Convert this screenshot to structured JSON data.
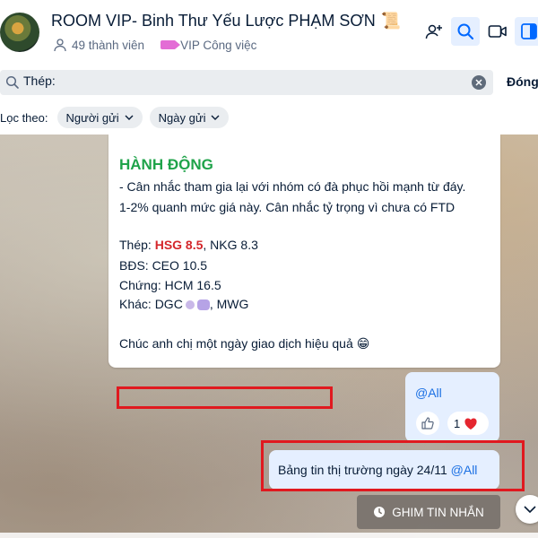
{
  "header": {
    "title": "ROOM VIP- Binh Thư Yếu Lược PHẠM SƠN",
    "title_emoji": "📜",
    "member_count": "49 thành viên",
    "category_tag": "VIP Công việc",
    "icons": [
      "add-member-icon",
      "search-icon",
      "video-call-icon",
      "sidebar-toggle-icon"
    ]
  },
  "search": {
    "query": "Thép:",
    "close_label": "Đóng"
  },
  "filters": {
    "label": "Lọc theo:",
    "sender": "Người gửi",
    "date": "Ngày gửi"
  },
  "messages": {
    "main": {
      "heading": "HÀNH ĐỘNG",
      "line1": "- Cân nhắc tham gia lại với nhóm có đà phục hồi mạnh từ đáy.",
      "line2": "1-2% quanh mức giá này. Cân nhắc tỷ trọng vì chưa có FTD",
      "steel_label": "Thép: ",
      "steel_hl": "HSG 8.5",
      "steel_rest": ", NKG 8.3",
      "bds": "BĐS: CEO 10.5",
      "securities": "Chứng: HCM 16.5",
      "other_label": "Khác: DGC",
      "other_rest": ", MWG",
      "closing": "Chúc anh chị một ngày giao dịch hiệu quả",
      "closing_emoji": "😁"
    },
    "mention_all": {
      "text": "@All",
      "reaction_count": "1"
    },
    "news": {
      "text": "Bảng tin thị trường ngày 24/11 ",
      "mention": "@All"
    }
  },
  "pin_button": "GHIM TIN NHẮN",
  "colors": {
    "accent": "#1a6fe3",
    "heading_green": "#1fa34a",
    "highlight_red": "#d4262b",
    "annotation_red": "#e0191f",
    "bubble_self": "#e5efff"
  }
}
